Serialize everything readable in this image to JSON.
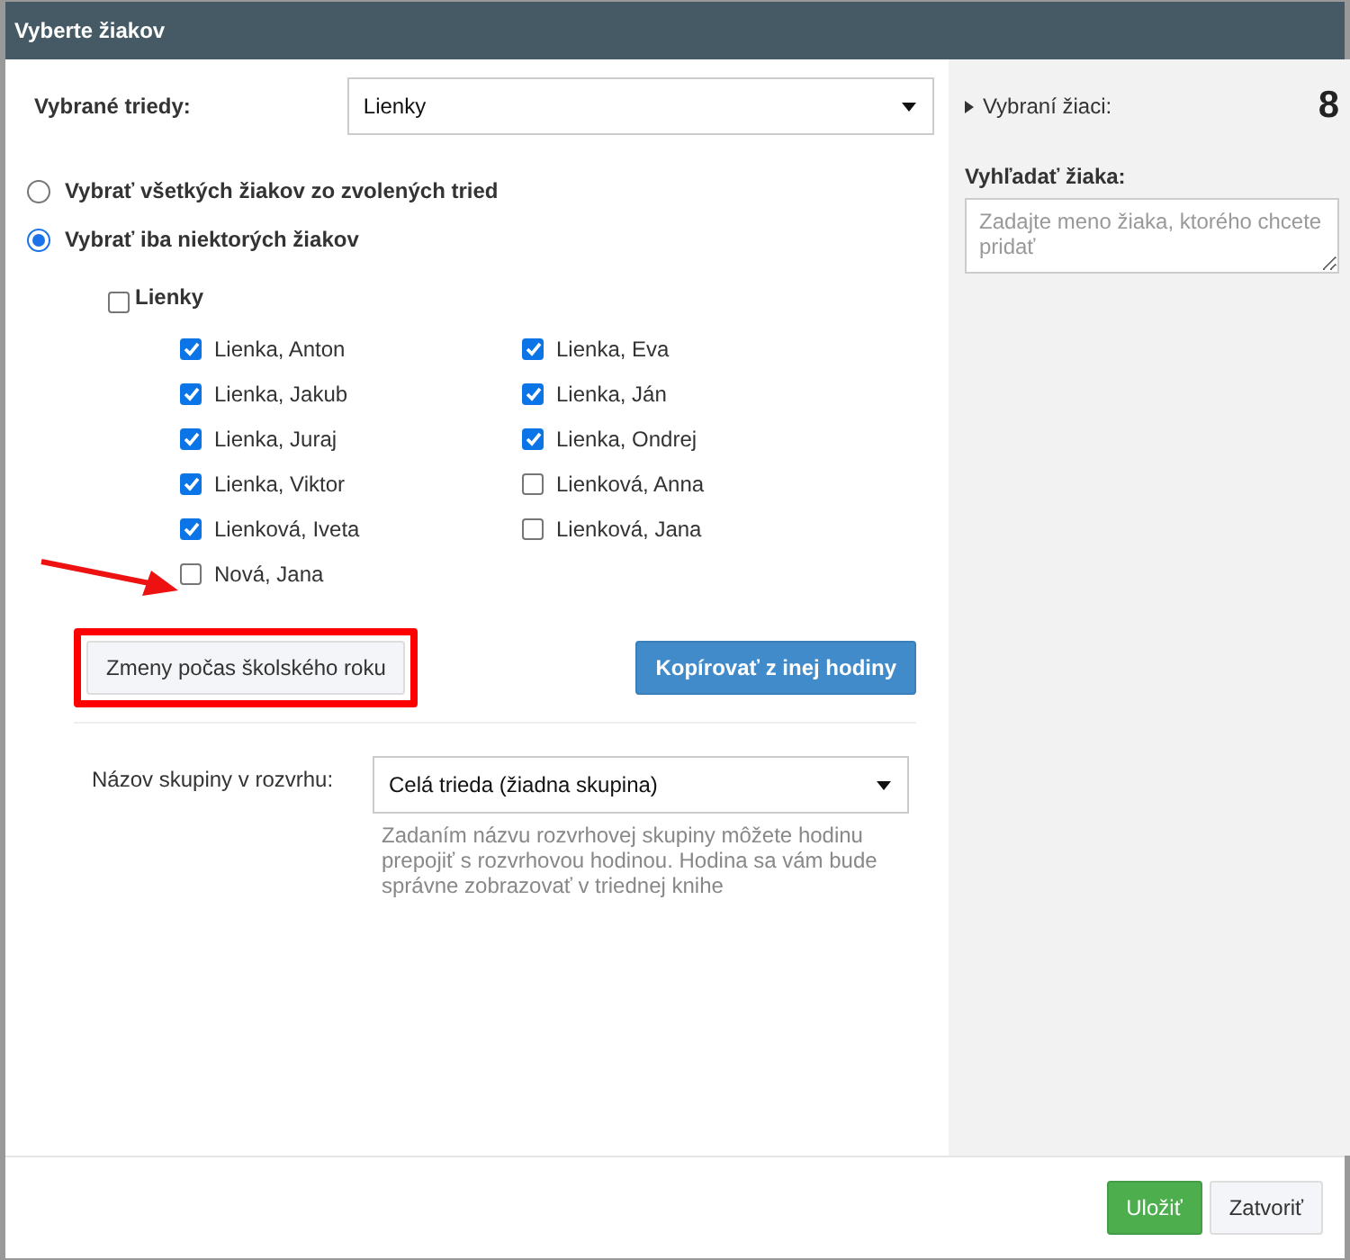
{
  "window": {
    "title": "Vyberte žiakov"
  },
  "class_select": {
    "label": "Vybrané triedy:",
    "value": "Lienky"
  },
  "modes": [
    {
      "label": "Vybrať všetkých žiakov zo zvolených tried",
      "selected": false
    },
    {
      "label": "Vybrať iba niektorých žiakov",
      "selected": true
    }
  ],
  "group": {
    "label": "Lienky",
    "checked": false
  },
  "students": [
    {
      "name": "Lienka, Anton",
      "checked": true
    },
    {
      "name": "Lienka, Eva",
      "checked": true
    },
    {
      "name": "Lienka, Jakub",
      "checked": true
    },
    {
      "name": "Lienka, Ján",
      "checked": true
    },
    {
      "name": "Lienka, Juraj",
      "checked": true
    },
    {
      "name": "Lienka, Ondrej",
      "checked": true
    },
    {
      "name": "Lienka, Viktor",
      "checked": true
    },
    {
      "name": "Lienková, Anna",
      "checked": false
    },
    {
      "name": "Lienková, Iveta",
      "checked": true
    },
    {
      "name": "Lienková, Jana",
      "checked": false
    },
    {
      "name": "Nová, Jana",
      "checked": false
    }
  ],
  "actions": {
    "changes": "Zmeny počas školského roku",
    "copy": "Kopírovať z inej hodiny"
  },
  "schedule_group": {
    "label": "Názov skupiny v rozvrhu:",
    "value": "Celá trieda (žiadna skupina)",
    "help": "Zadaním názvu rozvrhovej skupiny môžete hodinu prepojiť s rozvrhovou hodinou. Hodina sa vám bude správne zobrazovať v triednej knihe"
  },
  "sidebar": {
    "selected_label": "Vybraní žiaci:",
    "selected_count": "8",
    "search_label": "Vyhľadať žiaka:",
    "search_placeholder": "Zadajte meno žiaka, ktorého chcete pridať"
  },
  "footer": {
    "buttons": [
      {
        "label": "Uložiť",
        "kind": "primary"
      },
      {
        "label": "Zatvoriť",
        "kind": "default"
      }
    ]
  }
}
